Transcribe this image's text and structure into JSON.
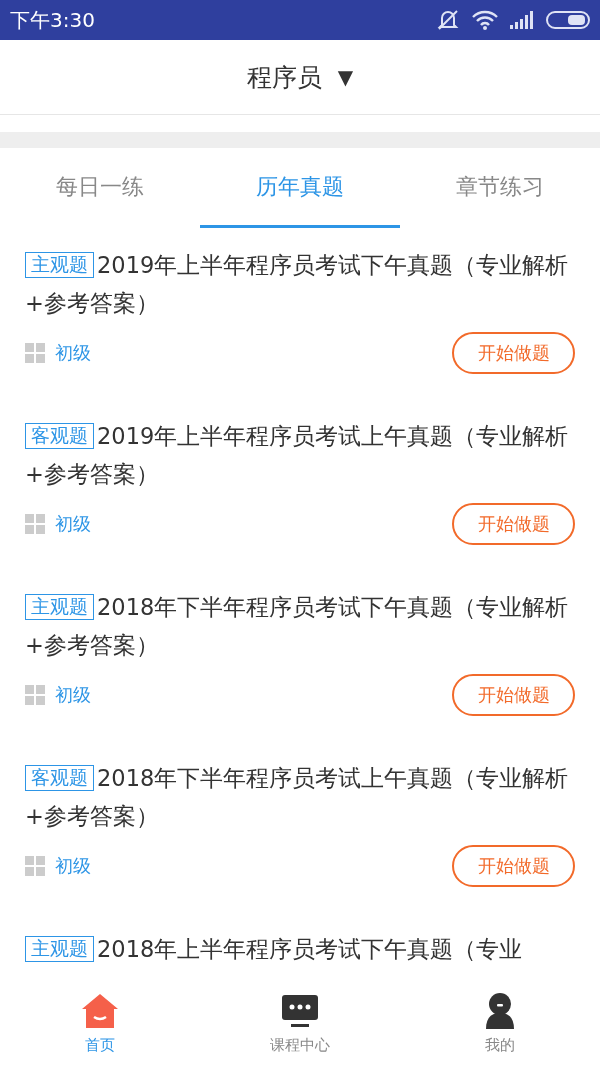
{
  "status_bar": {
    "time": "下午3:30"
  },
  "header": {
    "title": "程序员",
    "caret": "▼"
  },
  "tabs": [
    {
      "label": "每日一练",
      "selected": false
    },
    {
      "label": "历年真题",
      "selected": true
    },
    {
      "label": "章节练习",
      "selected": false
    }
  ],
  "items": [
    {
      "tag": "主观题",
      "title": "2019年上半年程序员考试下午真题（专业解析+参考答案）",
      "level": "初级",
      "button": "开始做题"
    },
    {
      "tag": "客观题",
      "title": "2019年上半年程序员考试上午真题（专业解析+参考答案）",
      "level": "初级",
      "button": "开始做题"
    },
    {
      "tag": "主观题",
      "title": "2018年下半年程序员考试下午真题（专业解析+参考答案）",
      "level": "初级",
      "button": "开始做题"
    },
    {
      "tag": "客观题",
      "title": "2018年下半年程序员考试上午真题（专业解析+参考答案）",
      "level": "初级",
      "button": "开始做题"
    },
    {
      "tag": "主观题",
      "title": "2018年上半年程序员考试下午真题（专业"
    }
  ],
  "bottom_nav": [
    {
      "kind": "home",
      "label": "首页",
      "selected": true
    },
    {
      "kind": "courses",
      "label": "课程中心",
      "selected": false
    },
    {
      "kind": "profile",
      "label": "我的",
      "selected": false
    }
  ]
}
